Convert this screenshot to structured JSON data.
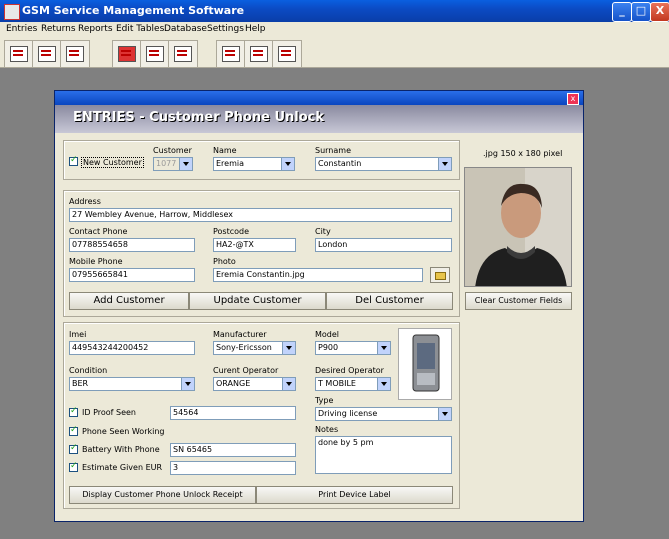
{
  "app": {
    "title": "GSM Service Management Software",
    "min": "_",
    "max": "□",
    "close": "X"
  },
  "menu": [
    "Entries",
    "Returns",
    "Reports",
    "Edit Tables",
    "Database",
    "Settings",
    "Help"
  ],
  "dialog": {
    "header": "ENTRIES  -  Customer Phone Unlock",
    "close": "x"
  },
  "customer": {
    "new_customer_label": "New Customer",
    "customer_label": "Customer",
    "customer_value": "1077",
    "name_label": "Name",
    "name_value": "Eremia",
    "surname_label": "Surname",
    "surname_value": "Constantin"
  },
  "address": {
    "address_label": "Address",
    "address_value": "27 Wembley Avenue, Harrow, Middlesex",
    "contact_label": "Contact Phone",
    "contact_value": "07788554658",
    "postcode_label": "Postcode",
    "postcode_value": "HA2-@TX",
    "city_label": "City",
    "city_value": "London",
    "mobile_label": "Mobile Phone",
    "mobile_value": "07955665841",
    "photo_label": "Photo",
    "photo_value": "Eremia Constantin.jpg"
  },
  "buttons": {
    "add": "Add Customer",
    "update": "Update Customer",
    "del": "Del Customer",
    "clear": "Clear Customer Fields",
    "receipt": "Display Customer Phone Unlock Receipt",
    "label": "Print Device Label"
  },
  "photo_caption": ".jpg  150 x 180 pixel",
  "device": {
    "imei_label": "Imei",
    "imei_value": "449543244200452",
    "manufacturer_label": "Manufacturer",
    "manufacturer_value": "Sony-Ericsson",
    "model_label": "Model",
    "model_value": "P900",
    "condition_label": "Condition",
    "condition_value": "BER",
    "current_op_label": "Curent Operator",
    "current_op_value": "ORANGE",
    "desired_op_label": "Desired Operator",
    "desired_op_value": "T MOBILE",
    "type_label": "Type",
    "type_value": "Driving license",
    "notes_label": "Notes",
    "notes_value": "done by 5 pm",
    "id_proof_label": "ID Proof Seen",
    "id_proof_value": "54564",
    "phone_working_label": "Phone Seen Working",
    "battery_label": "Battery With Phone",
    "battery_value": "SN 65465",
    "estimate_label": "Estimate Given EUR",
    "estimate_value": "3"
  }
}
